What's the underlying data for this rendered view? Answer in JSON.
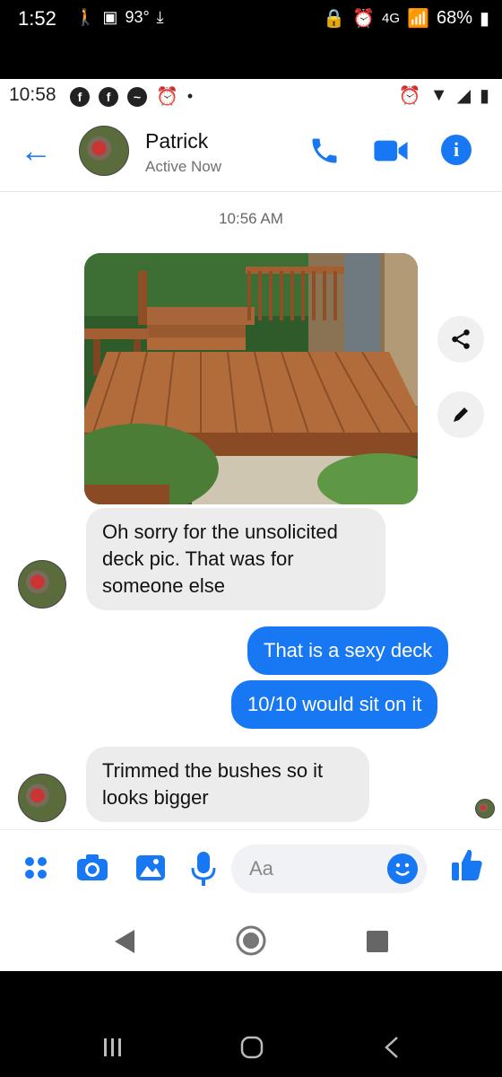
{
  "outer_status": {
    "time": "1:52",
    "temperature": "93°",
    "network": "4G",
    "battery": "68%"
  },
  "inner_status": {
    "time": "10:58",
    "notifications": [
      "facebook-icon",
      "facebook-icon",
      "messenger-icon",
      "alarm-icon",
      "dot"
    ]
  },
  "header": {
    "contact_name": "Patrick",
    "contact_status": "Active Now",
    "icons": [
      "back-arrow-icon",
      "phone-icon",
      "video-icon",
      "info-icon"
    ]
  },
  "conversation": {
    "timestamp": "10:56 AM",
    "photo_description": "wooden deck photo",
    "messages": [
      {
        "side": "in",
        "text": "Oh sorry for the unsolicited deck pic. That was for someone else"
      },
      {
        "side": "out",
        "text": "That is a sexy deck"
      },
      {
        "side": "out",
        "text": "10/10 would sit on it"
      },
      {
        "side": "in",
        "text": "Trimmed the bushes so it looks bigger"
      }
    ]
  },
  "composer": {
    "placeholder": "Aa",
    "icons": [
      "menu-dots-icon",
      "camera-icon",
      "gallery-icon",
      "microphone-icon",
      "emoji-icon",
      "thumbs-up-icon"
    ]
  },
  "colors": {
    "accent": "#1877f2",
    "incoming_bubble": "#ececec",
    "outgoing_bubble": "#1877f2"
  }
}
